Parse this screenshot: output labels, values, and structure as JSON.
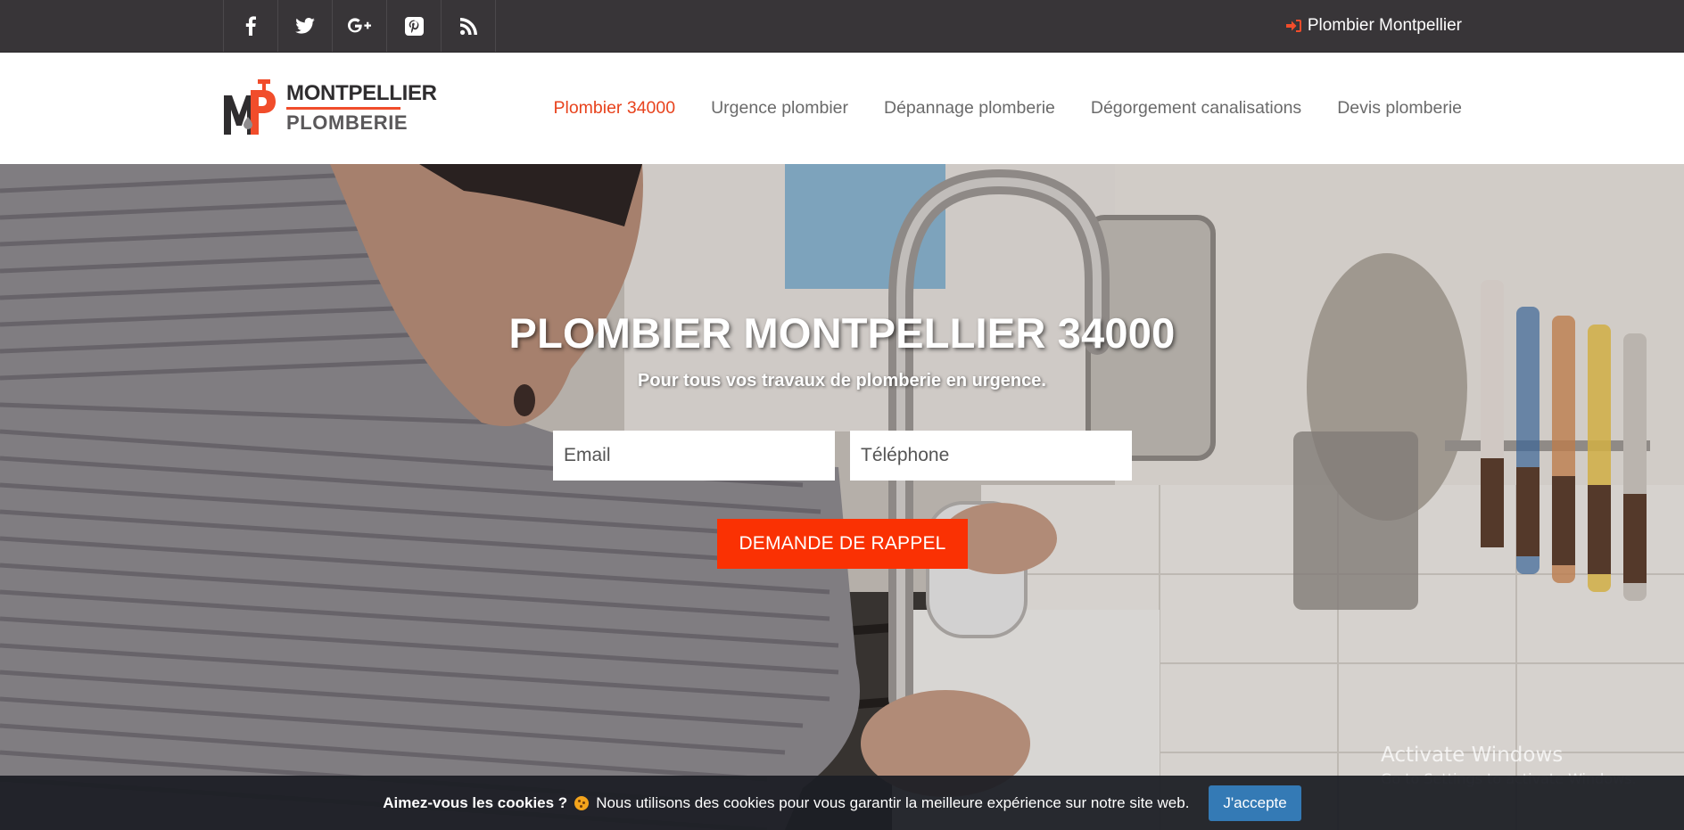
{
  "topbar": {
    "social": [
      {
        "icon": "facebook-icon"
      },
      {
        "icon": "twitter-icon"
      },
      {
        "icon": "google-plus-icon"
      },
      {
        "icon": "pinterest-icon"
      },
      {
        "icon": "rss-icon"
      }
    ],
    "login_icon": "sign-in-icon",
    "link_label": "Plombier Montpellier",
    "accent_color": "#f14d2b"
  },
  "header": {
    "logo": {
      "word1": "MONTPELLIER",
      "word2": "PLOMBERIE"
    },
    "nav": [
      {
        "label": "Plombier 34000",
        "active": true
      },
      {
        "label": "Urgence plombier"
      },
      {
        "label": "Dépannage plomberie"
      },
      {
        "label": "Dégorgement canalisations"
      },
      {
        "label": "Devis plomberie"
      }
    ],
    "active_color": "#e8431d"
  },
  "hero": {
    "title": "PLOMBIER MONTPELLIER 34000",
    "subtitle": "Pour tous vos travaux de plomberie en urgence.",
    "email_placeholder": "Email",
    "phone_placeholder": "Téléphone",
    "cta_label": "DEMANDE DE RAPPEL",
    "cta_color": "#fa3103"
  },
  "windows_watermark": {
    "line1": "Activate Windows",
    "line2": "Go to Settings to activate Windows."
  },
  "cookie": {
    "title": "Aimez-vous les cookies ?",
    "message": "Nous utilisons des cookies pour vous garantir la meilleure expérience sur notre site web.",
    "accept_label": "J'accepte",
    "button_color": "#347ab5"
  }
}
